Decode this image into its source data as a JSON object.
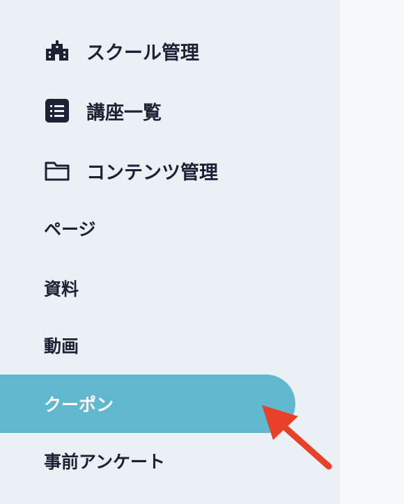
{
  "sidebar": {
    "items": [
      {
        "label": "スクール管理",
        "icon": "school-building-icon"
      },
      {
        "label": "講座一覧",
        "icon": "list-icon"
      },
      {
        "label": "コンテンツ管理",
        "icon": "folder-icon"
      },
      {
        "label": "ページ"
      },
      {
        "label": "資料"
      },
      {
        "label": "動画"
      },
      {
        "label": "クーポン",
        "active": true
      },
      {
        "label": "事前アンケート"
      }
    ]
  },
  "colors": {
    "sidebar_bg": "#ebf0f4",
    "main_bg": "#f7f9fb",
    "text": "#1c2135",
    "active_bg": "#5fb8ce",
    "active_text": "#ffffff",
    "annotation_arrow": "#e8412a"
  }
}
